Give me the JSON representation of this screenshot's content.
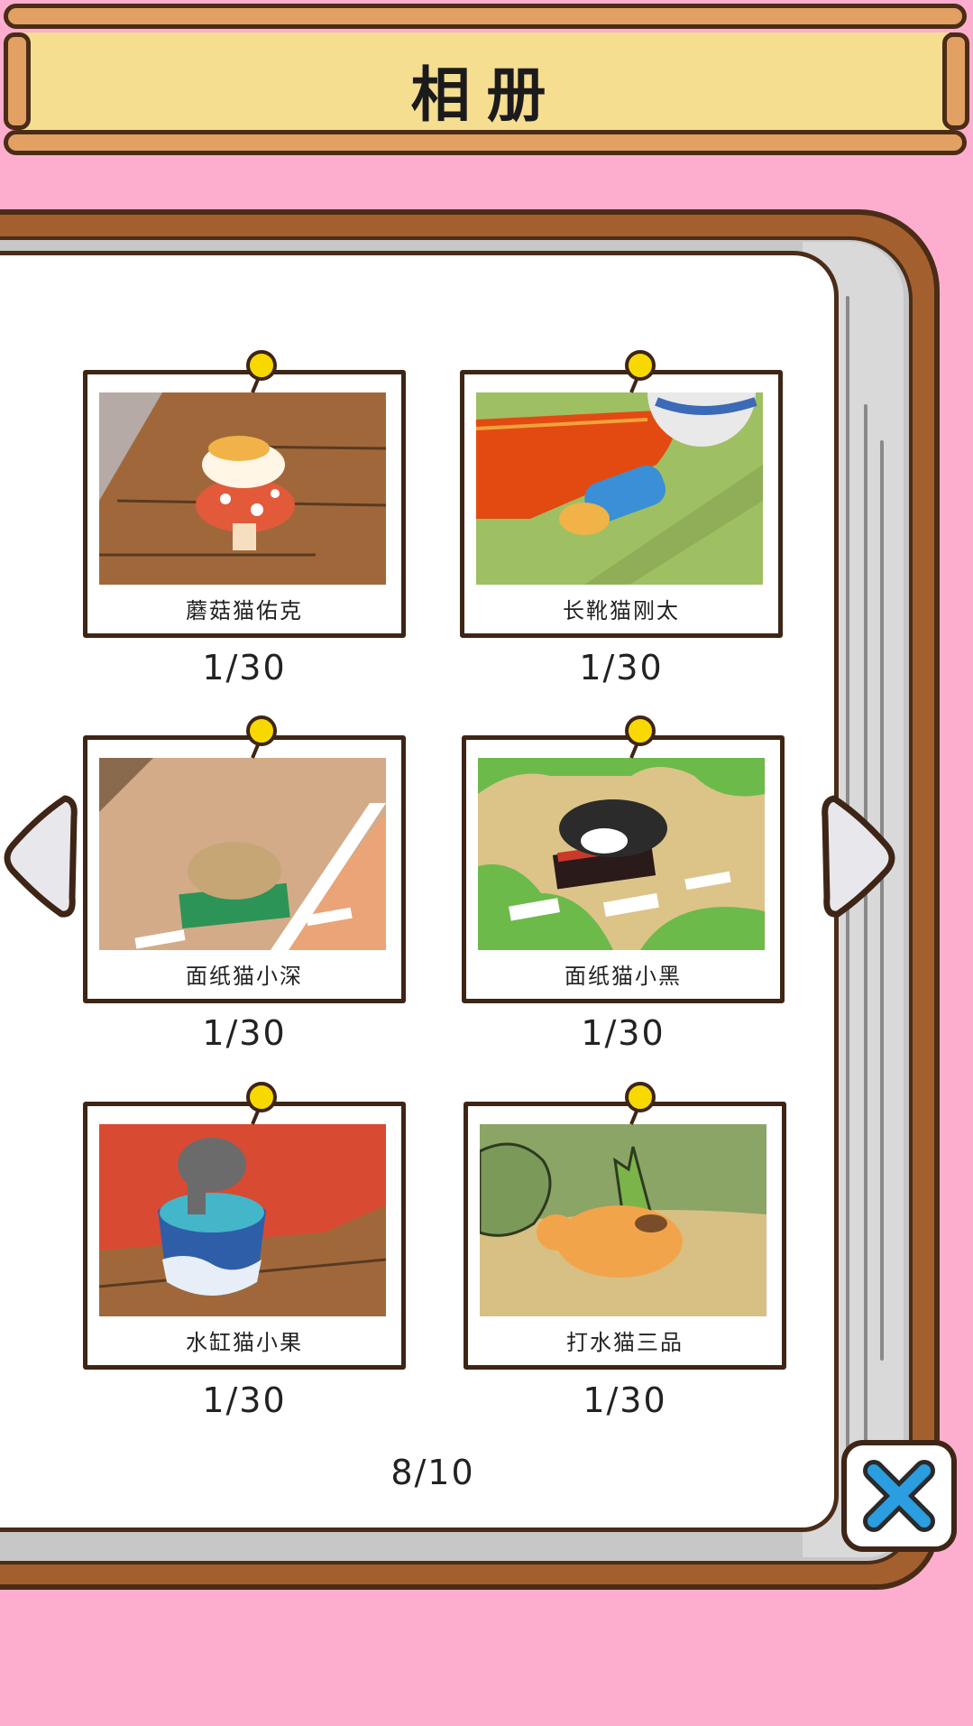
{
  "header": {
    "title": "相册"
  },
  "album": {
    "photos": [
      {
        "name": "蘑菇猫佑克",
        "count": "1/30"
      },
      {
        "name": "长靴猫刚太",
        "count": "1/30"
      },
      {
        "name": "面纸猫小深",
        "count": "1/30"
      },
      {
        "name": "面纸猫小黑",
        "count": "1/30"
      },
      {
        "name": "水缸猫小果",
        "count": "1/30"
      },
      {
        "name": "打水猫三品",
        "count": "1/30"
      }
    ],
    "page_indicator": "8/10"
  },
  "colors": {
    "background": "#fdaecf",
    "wood": "#a45f2e",
    "sign": "#f6de91",
    "outline": "#4a2c17",
    "pin": "#f7d900",
    "close_x": "#2a9ee0"
  },
  "icons": {
    "prev": "triangle-left-icon",
    "next": "triangle-right-icon",
    "close": "close-x-icon",
    "pin": "pushpin-icon"
  }
}
